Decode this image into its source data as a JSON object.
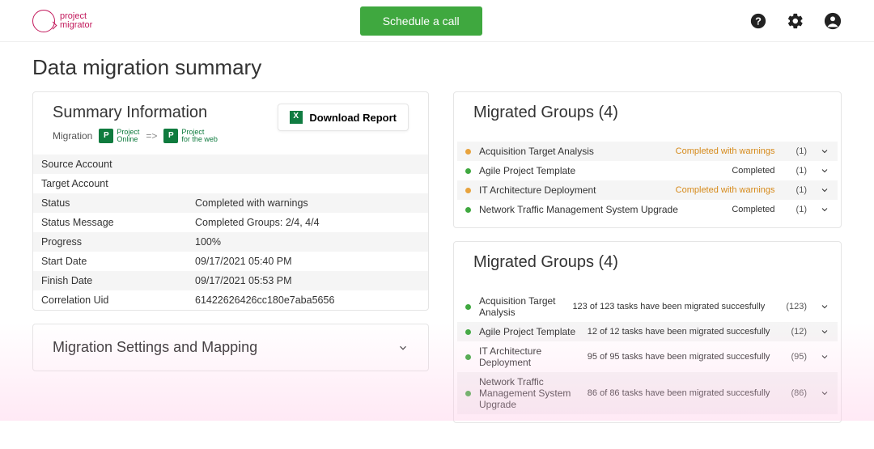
{
  "header": {
    "logo_top": "project",
    "logo_bottom": "migrator",
    "cta": "Schedule a call"
  },
  "page_title": "Data migration summary",
  "summary": {
    "title": "Summary Information",
    "download": "Download Report",
    "migration_label": "Migration",
    "source_app_top": "Project",
    "source_app_bottom": "Online",
    "arrow": "=>",
    "target_app_top": "Project",
    "target_app_bottom": "for the web",
    "rows": [
      {
        "k": "Source Account",
        "v": ""
      },
      {
        "k": "Target Account",
        "v": ""
      },
      {
        "k": "Status",
        "v": "Completed with warnings"
      },
      {
        "k": "Status Message",
        "v": "Completed Groups: 2/4, 4/4"
      },
      {
        "k": "Progress",
        "v": "100%"
      },
      {
        "k": "Start Date",
        "v": "09/17/2021 05:40 PM"
      },
      {
        "k": "Finish Date",
        "v": "09/17/2021 05:53 PM"
      },
      {
        "k": "Correlation Uid",
        "v": "61422626426cc180e7aba5656"
      }
    ]
  },
  "settings": {
    "title": "Migration Settings and Mapping"
  },
  "groups_a": {
    "title": "Migrated Groups (4)",
    "items": [
      {
        "name": "Acquisition Target Analysis",
        "status": "Completed with warnings",
        "warn": true,
        "count": "(1)"
      },
      {
        "name": "Agile Project Template",
        "status": "Completed",
        "warn": false,
        "count": "(1)"
      },
      {
        "name": "IT Architecture Deployment",
        "status": "Completed with warnings",
        "warn": true,
        "count": "(1)"
      },
      {
        "name": "Network Traffic Management System Upgrade",
        "status": "Completed",
        "warn": false,
        "count": "(1)"
      }
    ]
  },
  "groups_b": {
    "title": "Migrated Groups (4)",
    "items": [
      {
        "name": "Acquisition Target Analysis",
        "status": "123 of 123 tasks have been migrated succesfully",
        "warn": false,
        "count": "(123)"
      },
      {
        "name": "Agile Project Template",
        "status": "12 of 12 tasks have been migrated succesfully",
        "warn": false,
        "count": "(12)"
      },
      {
        "name": "IT Architecture Deployment",
        "status": "95 of 95 tasks have been migrated succesfully",
        "warn": false,
        "count": "(95)"
      },
      {
        "name": "Network Traffic Management System Upgrade",
        "status": "86 of 86 tasks have been migrated succesfully",
        "warn": false,
        "count": "(86)"
      }
    ]
  }
}
